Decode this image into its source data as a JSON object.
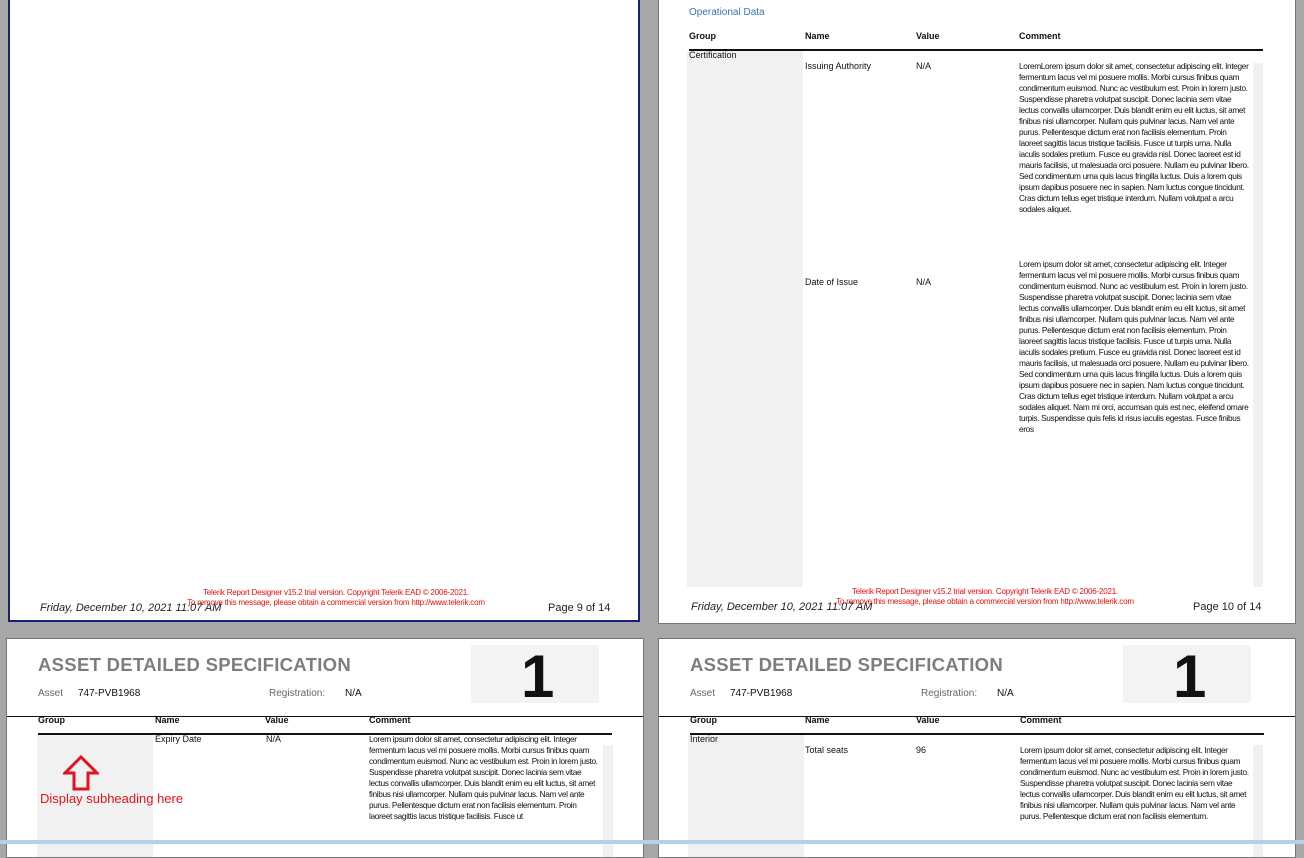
{
  "footer": {
    "date": "Friday, December 10, 2021 11:07 AM",
    "trial_line1": "Telerik Report Designer v15.2 trial version. Copyright Telerik EAD © 2006-2021.",
    "trial_line2": "To remove this message, please obtain a commercial version from http://www.telerik.com"
  },
  "page9": {
    "page_label": "Page 9 of 14"
  },
  "page10": {
    "page_label": "Page 10 of 14",
    "section_title": "Operational Data",
    "headers": {
      "group": "Group",
      "name": "Name",
      "value": "Value",
      "comment": "Comment"
    },
    "group": "Certification",
    "rows": [
      {
        "name": "Issuing Authority",
        "value": "N/A",
        "comment": "LoremLorem ipsum dolor sit amet, consectetur adipiscing elit. Integer fermentum lacus vel mi posuere mollis. Morbi cursus finibus quam condimentum euismod. Nunc ac vestibulum est. Proin in lorem justo. Suspendisse pharetra volutpat suscipit. Donec lacinia sem vitae lectus convallis ullamcorper. Duis blandit enim eu elit luctus, sit amet finibus nisi ullamcorper. Nullam quis pulvinar lacus. Nam vel ante purus. Pellentesque dictum erat non facilisis elementum. Proin laoreet sagittis lacus tristique facilisis. Fusce ut turpis urna. Nulla iaculis sodales pretium. Fusce eu gravida nisl. Donec laoreet est id mauris facilisis, ut malesuada orci posuere. Nullam eu pulvinar libero. Sed condimentum urna quis lacus fringilla luctus. Duis a lorem quis ipsum dapibus posuere nec in sapien. Nam luctus congue tincidunt. Cras dictum tellus eget tristique interdum. Nullam volutpat a arcu sodales aliquet."
      },
      {
        "name": "Date of Issue",
        "value": "N/A",
        "comment": "Lorem ipsum dolor sit amet, consectetur adipiscing elit. Integer fermentum lacus vel mi posuere mollis. Morbi cursus finibus quam condimentum euismod. Nunc ac vestibulum est. Proin in lorem justo. Suspendisse pharetra volutpat suscipit. Donec lacinia sem vitae lectus convallis ullamcorper. Duis blandit enim eu elit luctus, sit amet finibus nisi ullamcorper. Nullam quis pulvinar lacus. Nam vel ante purus. Pellentesque dictum erat non facilisis elementum. Proin laoreet sagittis lacus tristique facilisis. Fusce ut turpis urna. Nulla iaculis sodales pretium. Fusce eu gravida nisl. Donec laoreet est id mauris facilisis, ut malesuada orci posuere. Nullam eu pulvinar libero. Sed condimentum urna quis lacus fringilla luctus. Duis a lorem quis ipsum dapibus posuere nec in sapien. Nam luctus congue tincidunt. Cras dictum tellus eget tristique interdum. Nullam volutpat a arcu sodales aliquet.  Nam mi orci, accumsan quis est nec, eleifend ornare turpis. Suspendisse quis felis id risus iaculis egestas. Fusce finibus eros"
      }
    ]
  },
  "page11": {
    "title": "ASSET DETAILED SPECIFICATION",
    "number": "1",
    "asset_label": "Asset",
    "asset_value": "747-PVB1968",
    "registration_label": "Registration:",
    "registration_value": "N/A",
    "headers": {
      "group": "Group",
      "name": "Name",
      "value": "Value",
      "comment": "Comment"
    },
    "row": {
      "name": "Expiry Date",
      "value": "N/A",
      "comment": "Lorem ipsum dolor sit amet, consectetur adipiscing elit. Integer fermentum lacus vel mi posuere mollis. Morbi cursus finibus quam condimentum euismod. Nunc ac vestibulum est. Proin in lorem justo. Suspendisse pharetra volutpat suscipit. Donec lacinia sem vitae lectus convallis ullamcorper. Duis blandit enim eu elit luctus, sit amet finibus nisi ullamcorper. Nullam quis pulvinar lacus. Nam vel ante purus. Pellentesque dictum erat non facilisis elementum. Proin laoreet sagittis lacus tristique facilisis. Fusce ut"
    },
    "annotation": "Display subheading here"
  },
  "page12": {
    "title": "ASSET DETAILED SPECIFICATION",
    "number": "1",
    "asset_label": "Asset",
    "asset_value": "747-PVB1968",
    "registration_label": "Registration:",
    "registration_value": "N/A",
    "headers": {
      "group": "Group",
      "name": "Name",
      "value": "Value",
      "comment": "Comment"
    },
    "group": "Interior",
    "row": {
      "name": "Total seats",
      "value": "96",
      "comment": "Lorem ipsum dolor sit amet, consectetur adipiscing elit. Integer fermentum lacus vel mi posuere mollis. Morbi cursus finibus quam condimentum euismod. Nunc ac vestibulum est. Proin in lorem justo. Suspendisse pharetra volutpat suscipit. Donec lacinia sem vitae lectus convallis ullamcorper. Duis blandit enim eu elit luctus, sit amet finibus nisi ullamcorper. Nullam quis pulvinar lacus. Nam vel ante purus. Pellentesque dictum erat non facilisis elementum."
    }
  }
}
